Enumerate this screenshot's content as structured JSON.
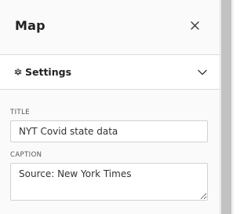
{
  "panel": {
    "title": "Map",
    "close_icon": "close-icon"
  },
  "settings_section": {
    "label": "Settings",
    "icon": "gear-icon",
    "toggle_icon": "chevron-down-icon",
    "expanded": true
  },
  "fields": {
    "title": {
      "label": "TITLE",
      "value": "NYT Covid state data"
    },
    "caption": {
      "label": "CAPTION",
      "value": "Source: New York Times"
    }
  }
}
